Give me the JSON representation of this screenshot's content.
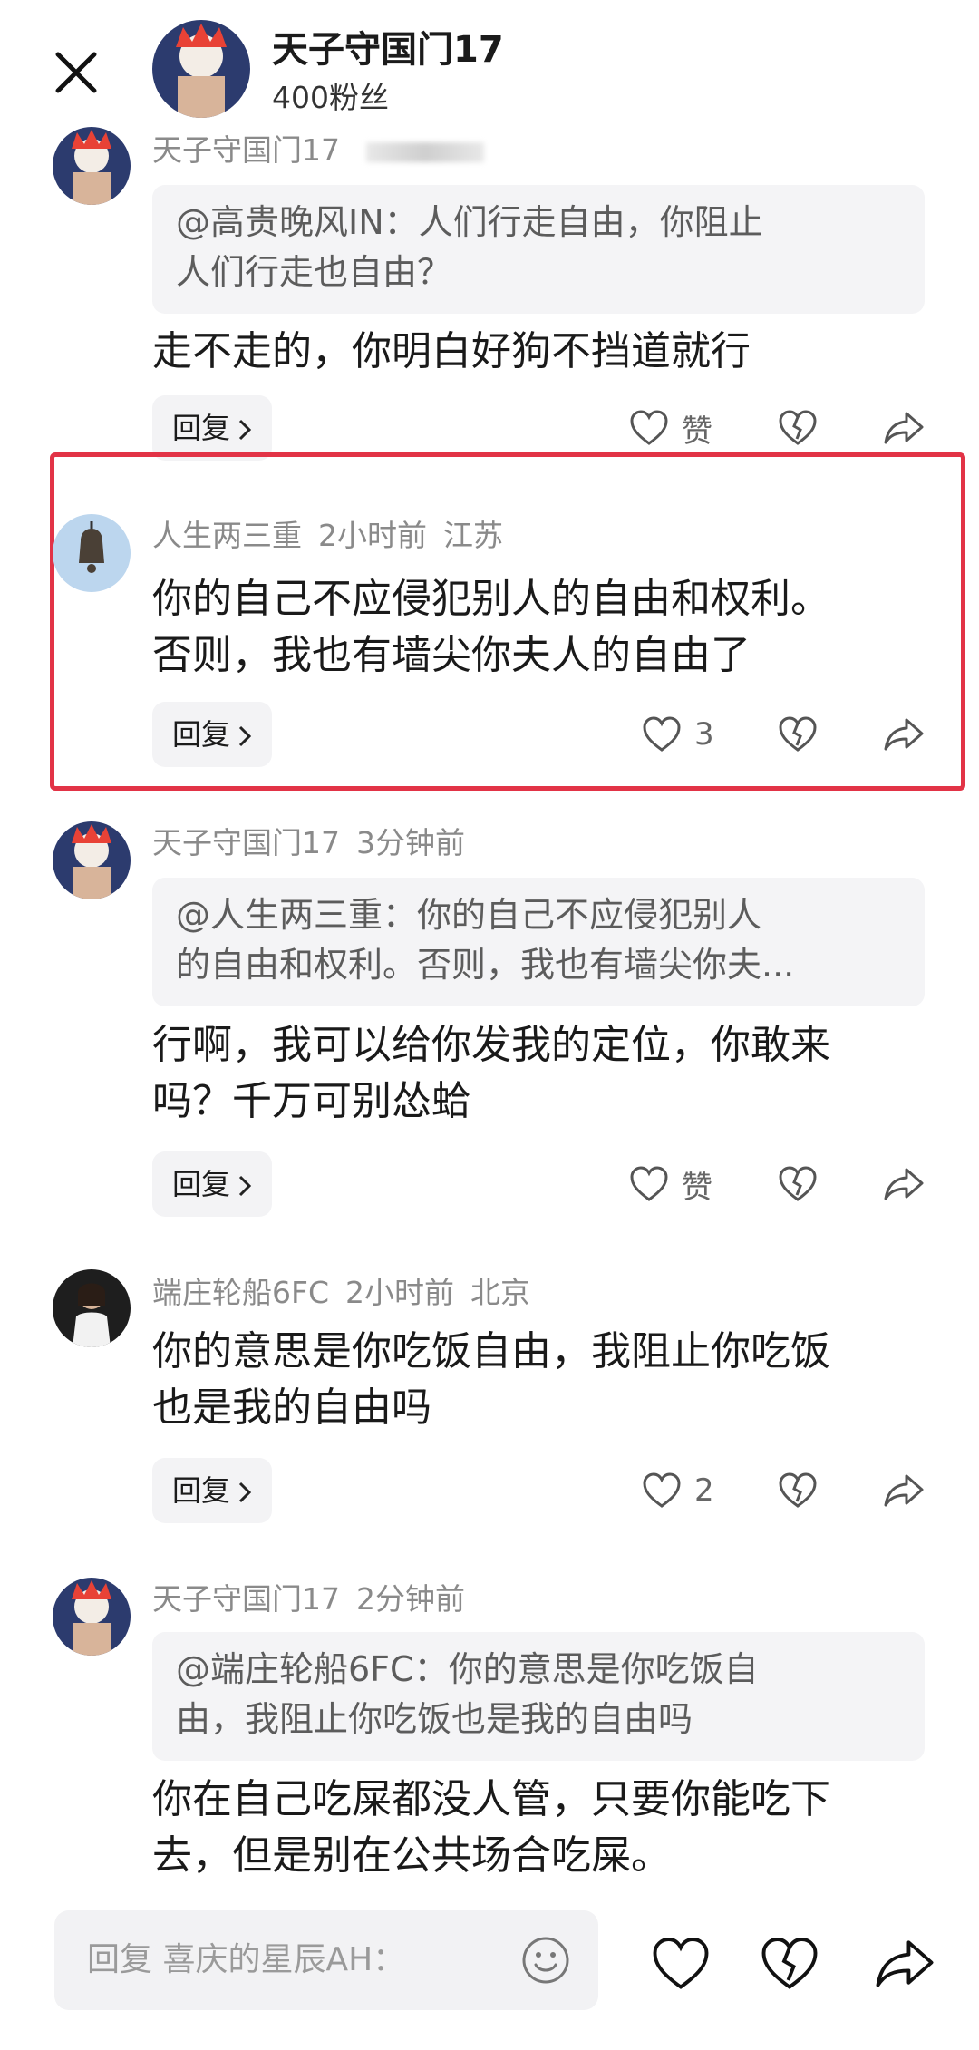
{
  "header": {
    "title": "天子守国门17",
    "subtitle": "400粉丝"
  },
  "comments": [
    {
      "author": "天子守国门17",
      "time": "",
      "location": "",
      "quote": [
        "@高贵晚风IN：人们行走自由，你阻止",
        "人们行走也自由？"
      ],
      "text": [
        "走不走的，你明白好狗不挡道就行"
      ],
      "reply_label": "回复",
      "like_count": "赞"
    },
    {
      "author": "人生两三重",
      "time": "2小时前",
      "location": "江苏",
      "text": [
        "你的自己不应侵犯别人的自由和权利。",
        "否则，我也有墙尖你夫人的自由了"
      ],
      "reply_label": "回复",
      "like_count": "3"
    },
    {
      "author": "天子守国门17",
      "time": "3分钟前",
      "location": "",
      "quote": [
        "@人生两三重：你的自己不应侵犯别人",
        "的自由和权利。否则，我也有墙尖你夫..."
      ],
      "text": [
        "行啊，我可以给你发我的定位，你敢来",
        "吗？千万可别怂蛤"
      ],
      "reply_label": "回复",
      "like_count": "赞"
    },
    {
      "author": "端庄轮船6FC",
      "time": "2小时前",
      "location": "北京",
      "text": [
        "你的意思是你吃饭自由，我阻止你吃饭",
        "也是我的自由吗"
      ],
      "reply_label": "回复",
      "like_count": "2"
    },
    {
      "author": "天子守国门17",
      "time": "2分钟前",
      "location": "",
      "quote": [
        "@端庄轮船6FC：你的意思是你吃饭自",
        "由，我阻止你吃饭也是我的自由吗"
      ],
      "text": [
        "你在自己吃屎都没人管，只要你能吃下",
        "去，但是别在公共场合吃屎。"
      ]
    }
  ],
  "bottom_bar": {
    "placeholder": "回复 喜庆的星辰AH："
  },
  "colors": {
    "highlight_border": "#e23346",
    "quote_bg": "#f4f4f6",
    "meta_text": "#8a8a8a"
  },
  "icons": [
    "close-icon",
    "heart-icon",
    "broken-heart-icon",
    "share-icon",
    "chevron-right-icon",
    "emoji-icon"
  ]
}
